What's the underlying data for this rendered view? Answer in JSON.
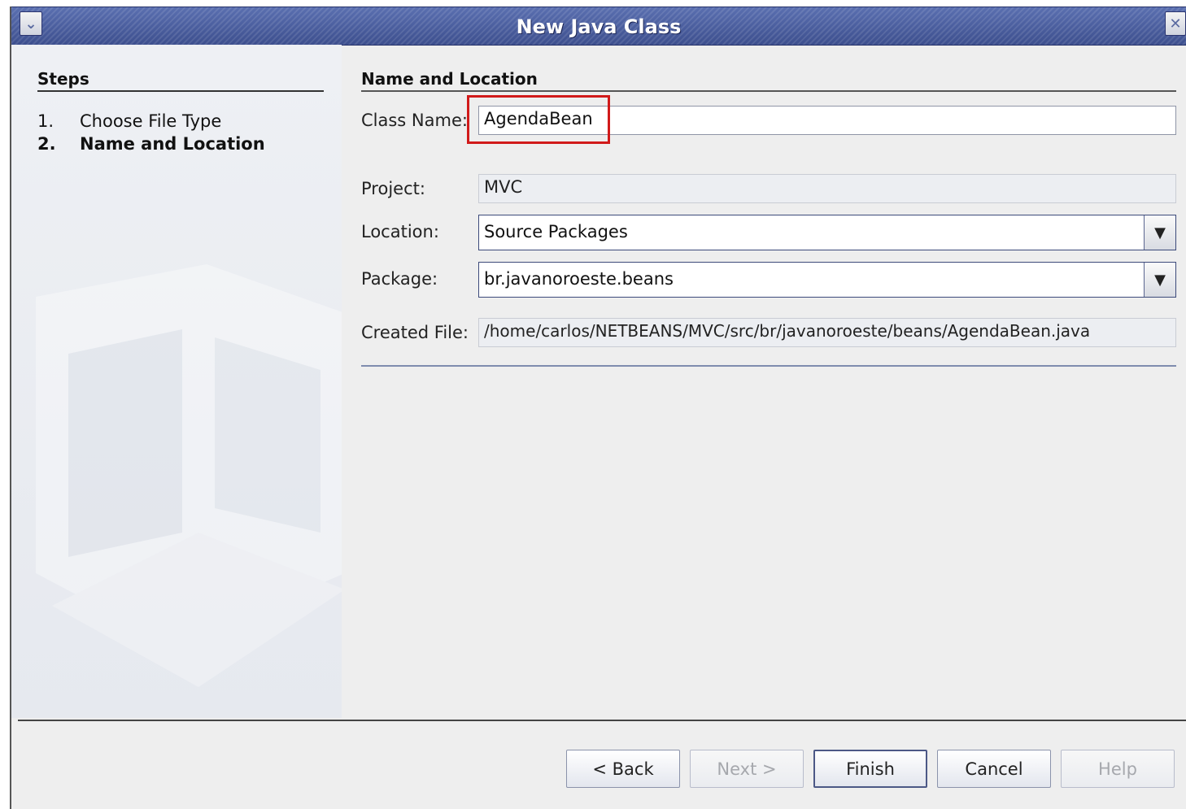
{
  "window": {
    "title": "New Java Class"
  },
  "steps": {
    "title": "Steps",
    "items": [
      {
        "num": "1.",
        "label": "Choose File Type"
      },
      {
        "num": "2.",
        "label": "Name and Location"
      }
    ]
  },
  "content": {
    "title": "Name and Location",
    "class_name": {
      "label": "Class Name:",
      "value": "AgendaBean"
    },
    "project": {
      "label": "Project:",
      "value": "MVC"
    },
    "location": {
      "label": "Location:",
      "value": "Source Packages"
    },
    "package": {
      "label": "Package:",
      "value": "br.javanoroeste.beans"
    },
    "created_file": {
      "label": "Created File:",
      "value": "/home/carlos/NETBEANS/MVC/src/br/javanoroeste/beans/AgendaBean.java"
    }
  },
  "buttons": {
    "back": "< Back",
    "next": "Next >",
    "finish": "Finish",
    "cancel": "Cancel",
    "help": "Help"
  },
  "icons": {
    "menu": "chevron-down-icon",
    "close": "close-icon",
    "dropdown": "triangle-down-icon"
  },
  "colors": {
    "titlebar": "#4a5ea0",
    "highlight": "#d11a1a"
  }
}
